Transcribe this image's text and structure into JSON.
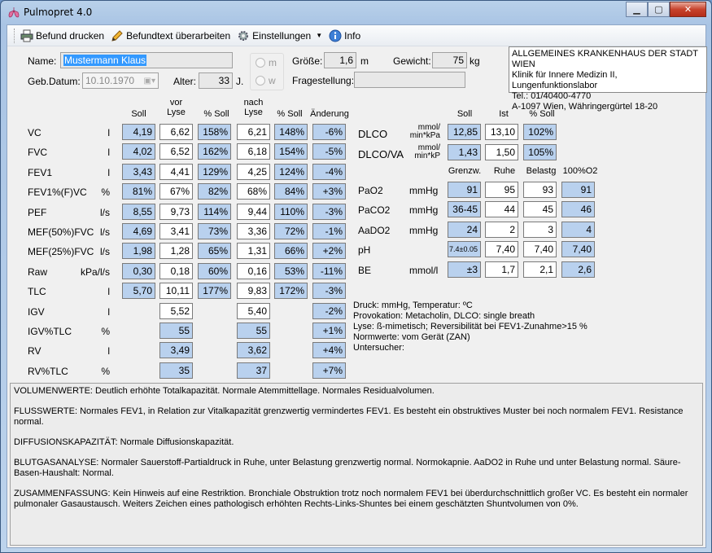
{
  "window": {
    "title": "Pulmopret 4.0"
  },
  "toolbar": {
    "print": "Befund drucken",
    "edit": "Befundtext überarbeiten",
    "settings": "Einstellungen",
    "info": "Info"
  },
  "patient": {
    "name_label": "Name:",
    "name": "Mustermann Klaus",
    "dob_label": "Geb.Datum:",
    "dob": "10.10.1970",
    "age_label": "Alter:",
    "age": "33",
    "age_unit": "J.",
    "sex_m": "m",
    "sex_w": "w",
    "height_label": "Größe:",
    "height": "1,6",
    "height_unit": "m",
    "weight_label": "Gewicht:",
    "weight": "75",
    "weight_unit": "kg",
    "question_label": "Fragestellung:",
    "question": ""
  },
  "hospital": {
    "line1": "ALLGEMEINES KRANKENHAUS DER STADT WIEN",
    "line2": "Klinik für Innere Medizin II, Lungenfunktionslabor",
    "line3": "Tel.: 01/40400-4770",
    "line4": "A-1097 Wien, Währingergürtel 18-20"
  },
  "lung_headers": {
    "soll": "Soll",
    "vor": "vor Lyse",
    "pct1": "% Soll",
    "nach": "nach Lyse",
    "pct2": "% Soll",
    "change": "Änderung"
  },
  "lung_rows": [
    {
      "name": "VC",
      "unit": "l",
      "soll": "4,19",
      "vor": "6,62",
      "p1": "158%",
      "nach": "6,21",
      "p2": "148%",
      "chg": "-6%"
    },
    {
      "name": "FVC",
      "unit": "l",
      "soll": "4,02",
      "vor": "6,52",
      "p1": "162%",
      "nach": "6,18",
      "p2": "154%",
      "chg": "-5%"
    },
    {
      "name": "FEV1",
      "unit": "l",
      "soll": "3,43",
      "vor": "4,41",
      "p1": "129%",
      "nach": "4,25",
      "p2": "124%",
      "chg": "-4%"
    },
    {
      "name": "FEV1%(F)VC",
      "unit": "%",
      "soll": "81%",
      "vor": "67%",
      "p1": "82%",
      "nach": "68%",
      "p2": "84%",
      "chg": "+3%"
    },
    {
      "name": "PEF",
      "unit": "l/s",
      "soll": "8,55",
      "vor": "9,73",
      "p1": "114%",
      "nach": "9,44",
      "p2": "110%",
      "chg": "-3%"
    },
    {
      "name": "MEF(50%)FVC",
      "unit": "l/s",
      "soll": "4,69",
      "vor": "3,41",
      "p1": "73%",
      "nach": "3,36",
      "p2": "72%",
      "chg": "-1%"
    },
    {
      "name": "MEF(25%)FVC",
      "unit": "l/s",
      "soll": "1,98",
      "vor": "1,28",
      "p1": "65%",
      "nach": "1,31",
      "p2": "66%",
      "chg": "+2%"
    },
    {
      "name": "Raw",
      "unit": "kPa/l/s",
      "soll": "0,30",
      "vor": "0,18",
      "p1": "60%",
      "nach": "0,16",
      "p2": "53%",
      "chg": "-11%"
    },
    {
      "name": "TLC",
      "unit": "l",
      "soll": "5,70",
      "vor": "10,11",
      "p1": "177%",
      "nach": "9,83",
      "p2": "172%",
      "chg": "-3%"
    },
    {
      "name": "IGV",
      "unit": "l",
      "soll": "",
      "vor": "5,52",
      "p1": "",
      "nach": "5,40",
      "p2": "",
      "chg": "-2%"
    },
    {
      "name": "IGV%TLC",
      "unit": "%",
      "soll": "",
      "vor": "55",
      "p1": "",
      "nach": "55",
      "p2": "",
      "chg": "+1%"
    },
    {
      "name": "RV",
      "unit": "l",
      "soll": "",
      "vor": "3,49",
      "p1": "",
      "nach": "3,62",
      "p2": "",
      "chg": "+4%"
    },
    {
      "name": "RV%TLC",
      "unit": "%",
      "soll": "",
      "vor": "35",
      "p1": "",
      "nach": "37",
      "p2": "",
      "chg": "+7%"
    }
  ],
  "dlco": {
    "h_soll": "Soll",
    "h_ist": "Ist",
    "h_pct": "% Soll",
    "rows": [
      {
        "name": "DLCO",
        "unit1": "mmol/",
        "unit2": "min*kPa",
        "soll": "12,85",
        "ist": "13,10",
        "pct": "102%"
      },
      {
        "name": "DLCO/VA",
        "unit1": "mmol/",
        "unit2": "min*kP",
        "soll": "1,43",
        "ist": "1,50",
        "pct": "105%"
      }
    ]
  },
  "bga": {
    "h_grenz": "Grenzw.",
    "h_ruhe": "Ruhe",
    "h_belastg": "Belastg",
    "h_o2": "100%O2",
    "rows": [
      {
        "name": "PaO2",
        "unit": "mmHg",
        "g": "91",
        "r": "95",
        "b": "93",
        "o": "91"
      },
      {
        "name": "PaCO2",
        "unit": "mmHg",
        "g": "36-45",
        "r": "44",
        "b": "45",
        "o": "46"
      },
      {
        "name": "AaDO2",
        "unit": "mmHg",
        "g": "24",
        "r": "2",
        "b": "3",
        "o": "4"
      },
      {
        "name": "pH",
        "unit": "",
        "g": "7.4±0.05",
        "r": "7,40",
        "b": "7,40",
        "o": "7,40"
      },
      {
        "name": "BE",
        "unit": "mmol/l",
        "g": "±3",
        "r": "1,7",
        "b": "2,1",
        "o": "2,6"
      }
    ]
  },
  "notes": [
    "Druck:  mmHg, Temperatur: ºC",
    "Provokation: Metacholin, DLCO: single breath",
    "Lyse: ß-mimetisch; Reversibilität bei FEV1-Zunahme>15 %",
    "Normwerte: vom Gerät (ZAN)",
    "Untersucher:"
  ],
  "report": [
    "VOLUMENWERTE: Deutlich erhöhte Totalkapazität. Normale Atemmittellage. Normales Residualvolumen.",
    "FLUSSWERTE: Normales FEV1, in Relation zur Vitalkapazität grenzwertig vermindertes FEV1. Es besteht ein obstruktives Muster bei noch normalem FEV1. Resistance normal.",
    "DIFFUSIONSKAPAZITÄT: Normale Diffusionskapazität.",
    "BLUTGASANALYSE: Normaler Sauerstoff-Partialdruck in Ruhe, unter Belastung grenzwertig normal. Normokapnie. AaDO2 in Ruhe und unter Belastung normal. Säure-Basen-Haushalt: Normal.",
    "ZUSAMMENFASSUNG: Kein Hinweis auf eine Restriktion. Bronchiale Obstruktion trotz noch normalem FEV1 bei überdurchschnittlich großer VC. Es besteht ein normaler pulmonaler Gasaustausch. Weiters Zeichen eines pathologisch erhöhten Rechts-Links-Shuntes bei einem geschätzten Shuntvolumen von 0%."
  ]
}
